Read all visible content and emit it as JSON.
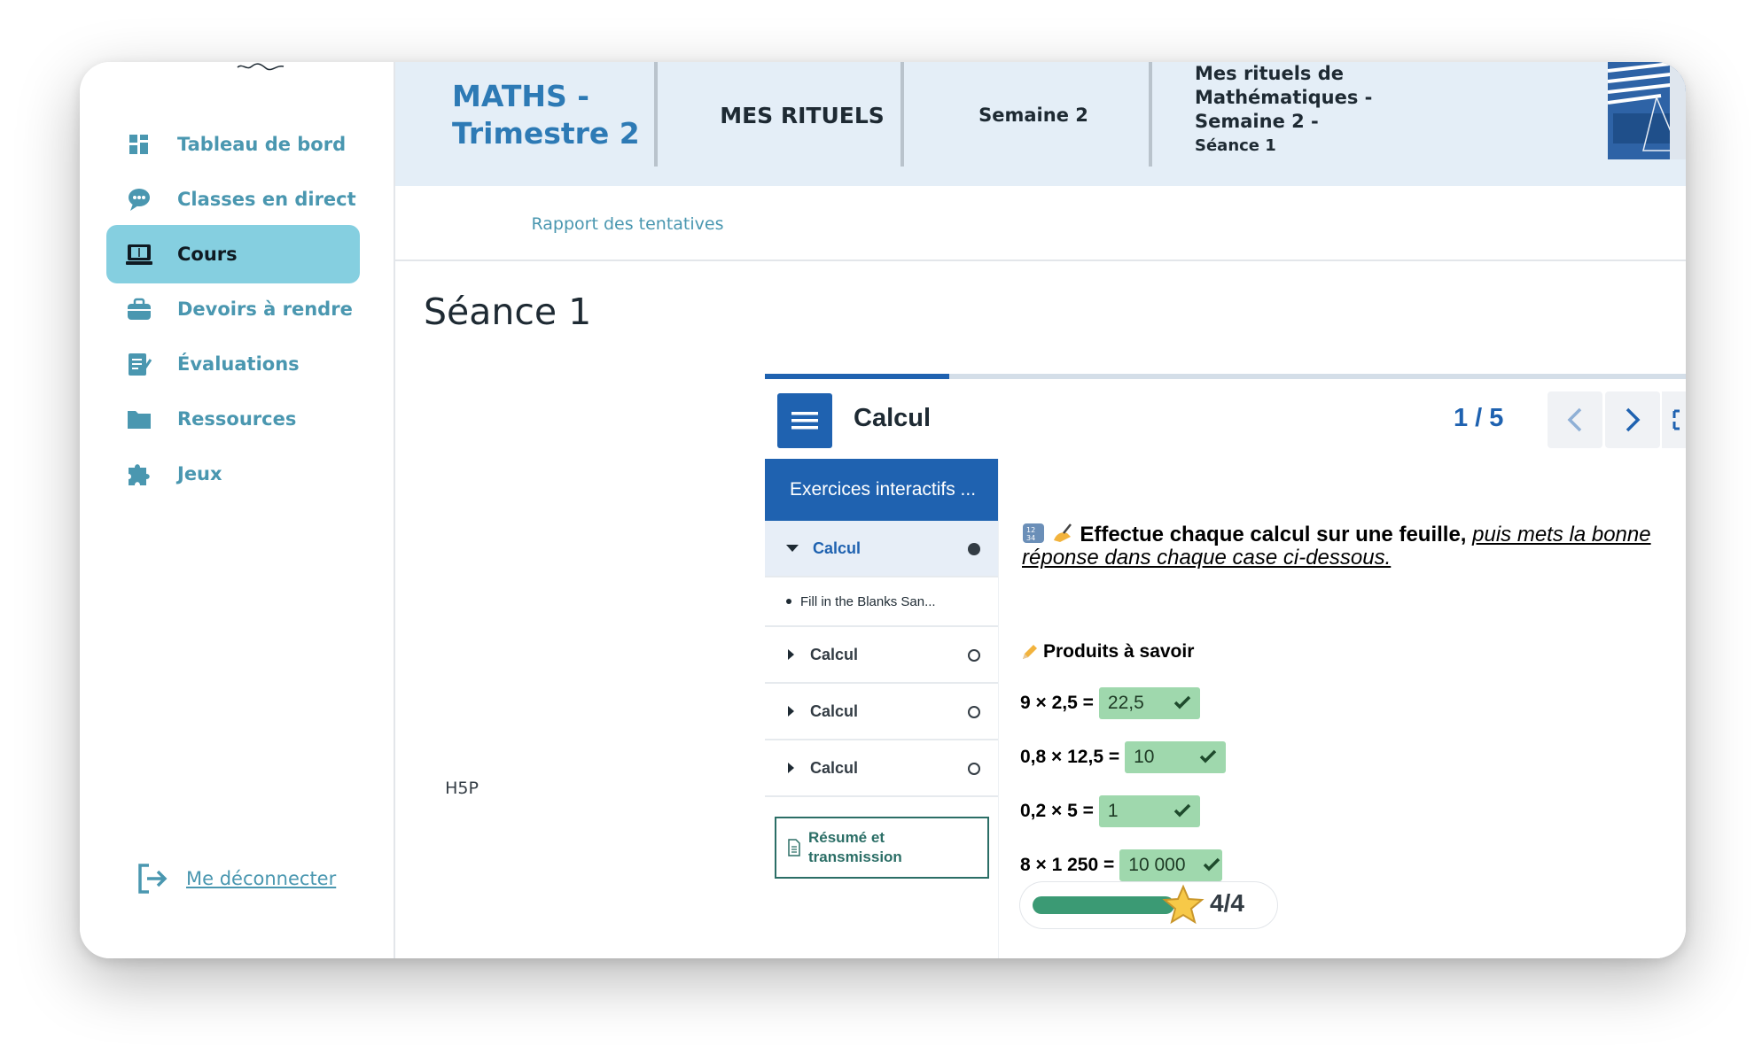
{
  "sidebar": {
    "items": [
      {
        "label": "Tableau de bord",
        "icon": "dashboard-icon"
      },
      {
        "label": "Classes en direct",
        "icon": "live-class-icon"
      },
      {
        "label": "Cours",
        "icon": "course-book-icon",
        "active": true
      },
      {
        "label": "Devoirs à rendre",
        "icon": "briefcase-icon"
      },
      {
        "label": "Évaluations",
        "icon": "checklist-icon"
      },
      {
        "label": "Ressources",
        "icon": "folder-icon"
      },
      {
        "label": "Jeux",
        "icon": "puzzle-icon"
      }
    ],
    "logout_label": "Me déconnecter"
  },
  "header": {
    "course": "MATHS - Trimestre 2",
    "category": "MES RITUELS",
    "week": "Semaine 2",
    "activity_title": "Mes rituels de Mathématiques - Semaine 2 -",
    "activity_subtitle": "Séance 1"
  },
  "tabs": [
    {
      "label": "H5P",
      "active": true
    },
    {
      "label": "Rapport des tentatives",
      "active": false
    }
  ],
  "page_title": "Séance 1",
  "h5p": {
    "title": "Calcul",
    "counter": "1 / 5",
    "progress": 0.2,
    "toc_header": "Exercices interactifs ...",
    "toc": {
      "current": "Calcul",
      "current_sub": "Fill in the Blanks San...",
      "others": [
        "Calcul",
        "Calcul",
        "Calcul"
      ]
    },
    "summary_line1": "Résumé et",
    "summary_line2": "transmission",
    "instruction_lead": "Effectue chaque calcul sur une feuille,",
    "instruction_emph": "puis mets la bonne réponse dans chaque case ci-dessous.",
    "subtitle": "Produits à savoir",
    "equations": [
      {
        "expr": "9 × 2,5 =",
        "answer": "22,5"
      },
      {
        "expr": "0,8 × 12,5 =",
        "answer": "10"
      },
      {
        "expr": "0,2 × 5 =",
        "answer": "1"
      },
      {
        "expr": "8 × 1 250 =",
        "answer": "10 000"
      }
    ],
    "score": "4/4",
    "score_fraction": 1.0
  },
  "colors": {
    "accent": "#4a97b0",
    "active_nav": "#85cfe0",
    "h5p_blue": "#1f62b0",
    "correct_green": "#9fd8ad"
  }
}
